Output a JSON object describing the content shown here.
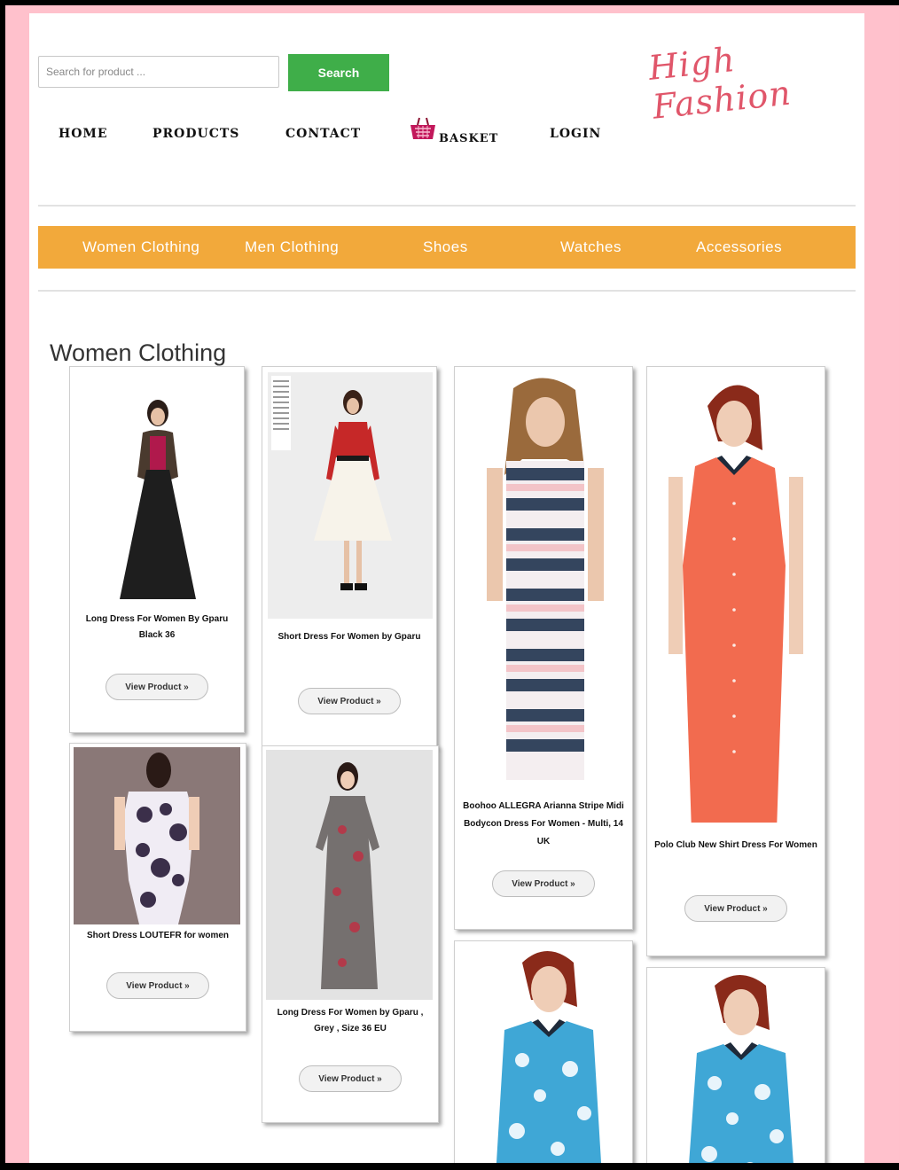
{
  "header": {
    "search_placeholder": "Search for product ...",
    "search_button": "Search",
    "logo_text": "High Fashion"
  },
  "nav": {
    "home": "HOME",
    "products": "PRODUCTS",
    "contact": "CONTACT",
    "basket": "BASKET",
    "login": "LOGIN"
  },
  "categories": [
    "Women Clothing",
    "Men Clothing",
    "Shoes",
    "Watches",
    "Accessories"
  ],
  "section_title": "Women Clothing",
  "products": [
    {
      "title": "Long Dress For Women By Gparu Black 36",
      "button": "View Product »"
    },
    {
      "title": "Short Dress For Women by Gparu",
      "button": "View Product »"
    },
    {
      "title": "Boohoo ALLEGRA Arianna Stripe Midi Bodycon Dress For Women - Multi, 14 UK",
      "button": "View Product »"
    },
    {
      "title": "Polo Club New Shirt Dress For Women",
      "button": "View Product »"
    },
    {
      "title": "Short Dress LOUTEFR for women",
      "button": "View Product »"
    },
    {
      "title": "Long Dress For Women by Gparu , Grey , Size 36 EU",
      "button": "View Product »"
    }
  ],
  "colors": {
    "search_button": "#3fae49",
    "category_bar": "#f2a93b",
    "logo": "#e0566a",
    "page_background": "#ffc1cc"
  }
}
